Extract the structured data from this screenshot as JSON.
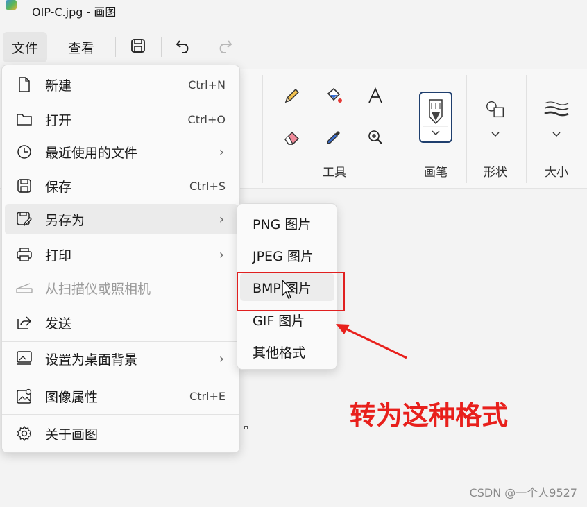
{
  "window": {
    "title": "OIP-C.jpg - 画图"
  },
  "menubar": {
    "file_label": "文件",
    "view_label": "查看",
    "save_icon": "save-icon",
    "undo_icon": "undo-icon",
    "redo_icon": "redo-icon"
  },
  "ribbon": {
    "tools_label": "工具",
    "brush_label": "画笔",
    "shapes_label": "形状",
    "size_label": "大小",
    "tool_icons": [
      "pencil-icon",
      "fill-icon",
      "text-icon",
      "eraser-icon",
      "color-picker-icon",
      "magnifier-icon"
    ]
  },
  "file_menu": {
    "items": [
      {
        "label": "新建",
        "shortcut": "Ctrl+N",
        "icon": "new-file-icon"
      },
      {
        "label": "打开",
        "shortcut": "Ctrl+O",
        "icon": "open-folder-icon"
      },
      {
        "label": "最近使用的文件",
        "chevron": "›",
        "icon": "recent-clock-icon"
      },
      {
        "label": "保存",
        "shortcut": "Ctrl+S",
        "icon": "save-icon"
      },
      {
        "label": "另存为",
        "chevron": "›",
        "icon": "save-as-icon"
      },
      {
        "label": "打印",
        "chevron": "›",
        "icon": "printer-icon"
      },
      {
        "label": "从扫描仪或照相机",
        "icon": "scanner-icon",
        "disabled": true
      },
      {
        "label": "发送",
        "icon": "share-icon"
      },
      {
        "label": "设置为桌面背景",
        "chevron": "›",
        "icon": "desktop-background-icon"
      },
      {
        "label": "图像属性",
        "shortcut": "Ctrl+E",
        "icon": "image-properties-icon"
      },
      {
        "label": "关于画图",
        "icon": "settings-gear-icon"
      }
    ]
  },
  "save_as_submenu": {
    "items": [
      "PNG 图片",
      "JPEG 图片",
      "BMP 图片",
      "GIF 图片",
      "其他格式"
    ]
  },
  "annotation": {
    "text": "转为这种格式",
    "color": "#e8201c"
  },
  "watermark": "CSDN @一个人9527"
}
